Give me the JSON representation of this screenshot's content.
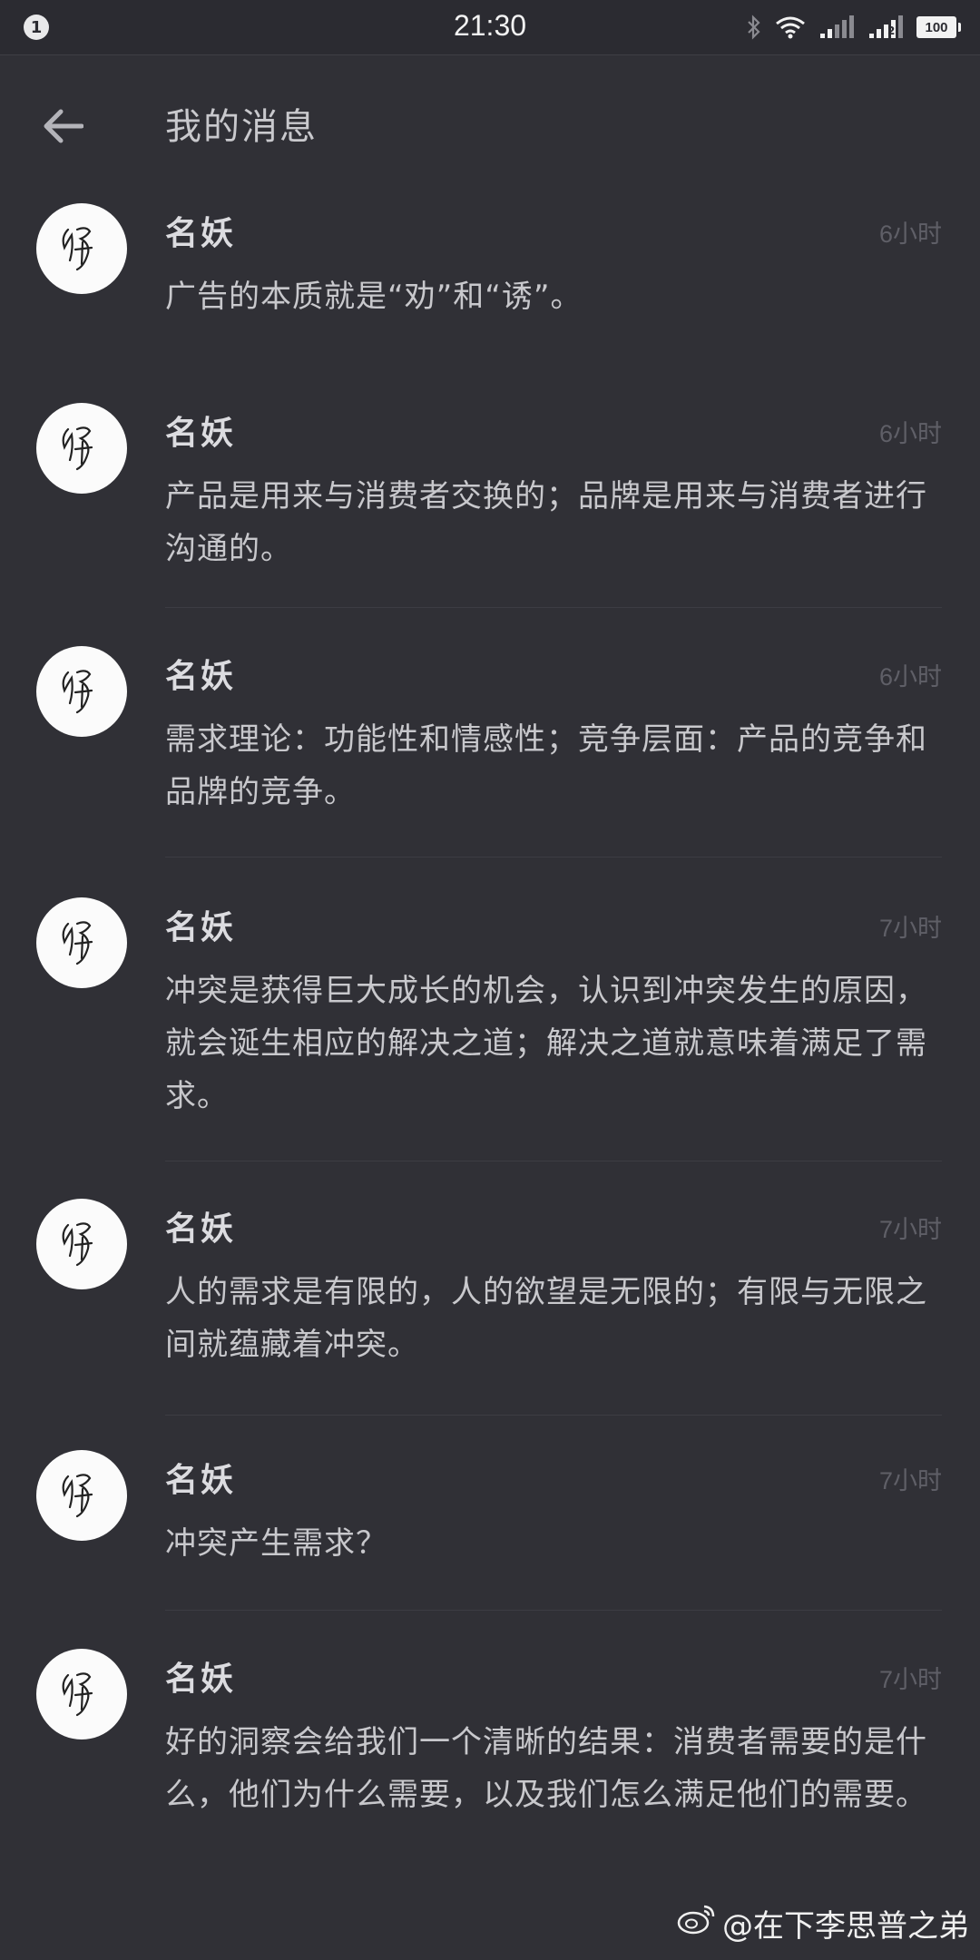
{
  "status_bar": {
    "notification_count": "1",
    "time": "21:30",
    "battery": "100",
    "sim_label": "2"
  },
  "header": {
    "title": "我的消息"
  },
  "messages": [
    {
      "sender": "名妖",
      "time": "6小时",
      "text": "广告的本质就是“劝”和“诱”。"
    },
    {
      "sender": "名妖",
      "time": "6小时",
      "text": "产品是用来与消费者交换的；品牌是用来与消费者进行沟通的。"
    },
    {
      "sender": "名妖",
      "time": "6小时",
      "text": "需求理论：功能性和情感性；竞争层面：产品的竞争和品牌的竞争。"
    },
    {
      "sender": "名妖",
      "time": "7小时",
      "text": "冲突是获得巨大成长的机会，认识到冲突发生的原因，就会诞生相应的解决之道；解决之道就意味着满足了需求。"
    },
    {
      "sender": "名妖",
      "time": "7小时",
      "text": "人的需求是有限的，人的欲望是无限的；有限与无限之间就蕴藏着冲突。"
    },
    {
      "sender": "名妖",
      "time": "7小时",
      "text": "冲突产生需求？"
    },
    {
      "sender": "名妖",
      "time": "7小时",
      "text": "好的洞察会给我们一个清晰的结果：消费者需要的是什么，他们为什么需要，以及我们怎么满足他们的需要。"
    }
  ],
  "watermark": {
    "text": "@在下李思普之弟"
  },
  "icons": [
    "back-arrow-icon",
    "bluetooth-icon",
    "wifi-icon",
    "signal-icon",
    "battery-icon",
    "weibo-icon"
  ],
  "colors": {
    "background": "#303036",
    "status_bar": "#2b2b31",
    "text": "#c8c8cc",
    "timestamp": "#5f5f67"
  }
}
